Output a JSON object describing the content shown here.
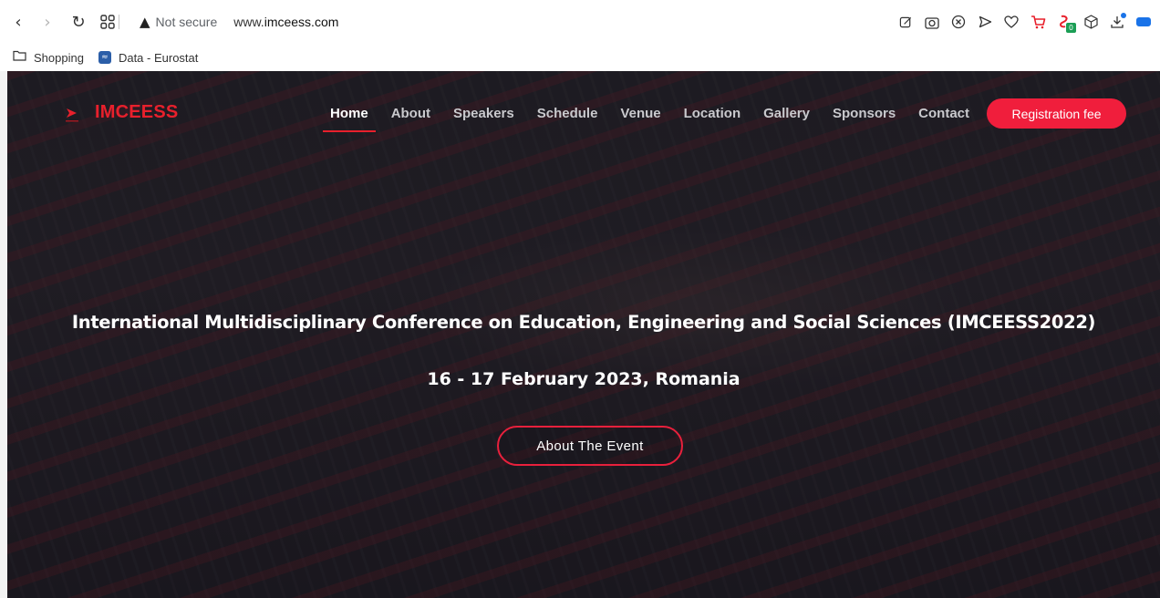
{
  "browser": {
    "address": {
      "security_label": "Not secure",
      "url_prefix": "www.",
      "url_host": "imceess.com"
    },
    "nav_icons": [
      "back-icon",
      "forward-icon",
      "reload-icon",
      "tabs-grid-icon"
    ],
    "toolbar_icons": [
      "edit-icon",
      "screenshot-icon",
      "shield-icon",
      "send-icon",
      "heart-icon",
      "cart-icon",
      "extension-icon",
      "cube-icon",
      "download-icon",
      "battery-icon"
    ],
    "extension_badge": "0",
    "bookmarks": [
      {
        "label": "Shopping",
        "icon": "folder-icon"
      },
      {
        "label": "Data - Eurostat",
        "icon": "eurostat-icon"
      }
    ]
  },
  "site": {
    "logo_text": "IMCEESS",
    "menu": [
      {
        "label": "Home",
        "active": true
      },
      {
        "label": "About"
      },
      {
        "label": "Speakers"
      },
      {
        "label": "Schedule"
      },
      {
        "label": "Venue"
      },
      {
        "label": "Location"
      },
      {
        "label": "Gallery"
      },
      {
        "label": "Sponsors"
      },
      {
        "label": "Contact"
      }
    ],
    "registration_label": "Registration fee",
    "hero": {
      "title": "International Multidisciplinary Conference on Education, Engineering and Social Sciences (IMCEESS2022)",
      "date": "16 - 17 February 2023, Romania",
      "button_label": "About The Event"
    },
    "colors": {
      "accent": "#e8202c",
      "button": "#f01e3c"
    }
  }
}
